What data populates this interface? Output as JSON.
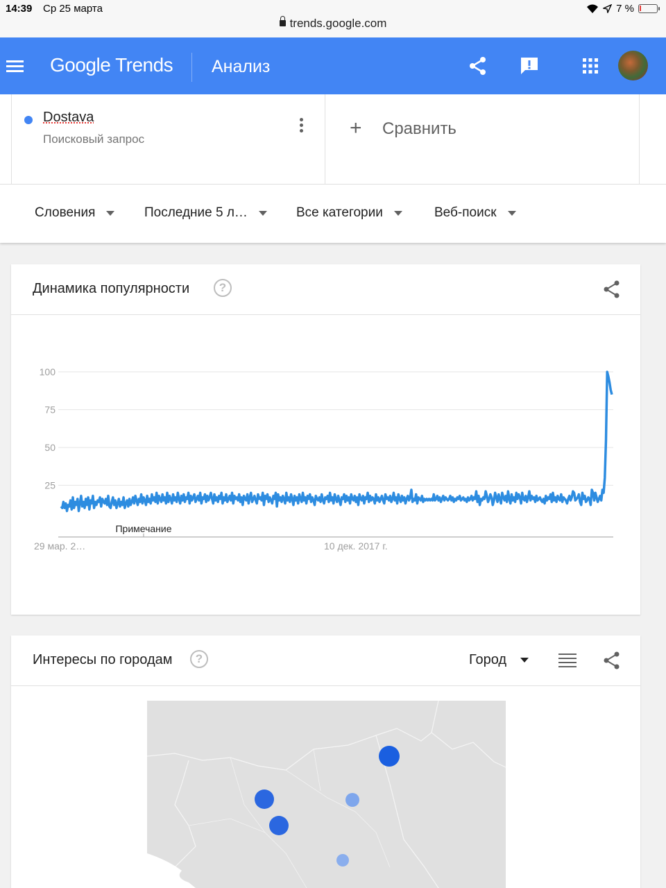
{
  "status_bar": {
    "time": "14:39",
    "date": "Ср 25 марта",
    "battery": "7 %"
  },
  "url": "trends.google.com",
  "app_bar": {
    "logo_google": "Google",
    "logo_trends": "Trends",
    "title": "Анализ"
  },
  "search_term": {
    "name": "Dostava",
    "type": "Поисковый запрос",
    "color": "#4285f4"
  },
  "compare": {
    "plus": "+",
    "label": "Сравнить"
  },
  "filters": [
    {
      "label": "Словения"
    },
    {
      "label": "Последние 5 л…"
    },
    {
      "label": "Все категории"
    },
    {
      "label": "Веб-поиск"
    }
  ],
  "interest_over_time": {
    "title": "Динамика популярности",
    "help": "?",
    "note_label": "Примечание"
  },
  "chart_data": {
    "type": "line",
    "title": "Динамика популярности",
    "y_ticks": [
      "100",
      "75",
      "50",
      "25"
    ],
    "x_tick_labels": [
      "29 мар. 2…",
      "10 дек. 2017 г."
    ],
    "ylim": [
      0,
      100
    ],
    "grid": true,
    "series": [
      {
        "name": "Dostava",
        "color": "#2d8ce0",
        "values": [
          11,
          10,
          14,
          10,
          13,
          8,
          12,
          11,
          15,
          9,
          17,
          10,
          14,
          12,
          16,
          8,
          13,
          18,
          11,
          14,
          10,
          16,
          12,
          17,
          9,
          15,
          13,
          18,
          10,
          14,
          12,
          15,
          14,
          17,
          11,
          16,
          14,
          13,
          16,
          12,
          18,
          11,
          10,
          14,
          17,
          12,
          15,
          10,
          13,
          16,
          11,
          14,
          12,
          17,
          10,
          13,
          15,
          11,
          16,
          12,
          14,
          17,
          13,
          18,
          15,
          12,
          16,
          14,
          19,
          13,
          17,
          15,
          12,
          18,
          14,
          16,
          13,
          19,
          15,
          17,
          14,
          20,
          13,
          18,
          16,
          14,
          19,
          15,
          17,
          13,
          20,
          14,
          18,
          16,
          13,
          19,
          15,
          17,
          14,
          20,
          16,
          13,
          18,
          15,
          19,
          14,
          17,
          16,
          20,
          13,
          18,
          15,
          17,
          19,
          14,
          16,
          18,
          15,
          20,
          13,
          17,
          16,
          19,
          14,
          18,
          15,
          17,
          20,
          16,
          13,
          19,
          15,
          17,
          14,
          18,
          16,
          20,
          13,
          17,
          15,
          19,
          14,
          16,
          18,
          15,
          20,
          13,
          18,
          16,
          17,
          15,
          19,
          14,
          17,
          12,
          18,
          16,
          15,
          19,
          13,
          17,
          20,
          14,
          16,
          18,
          15,
          13,
          19,
          16,
          17,
          15,
          20,
          12,
          18,
          16,
          19,
          14,
          17,
          15,
          13,
          18,
          16,
          20,
          11,
          19,
          15,
          17,
          14,
          18,
          16,
          13,
          20,
          15,
          17,
          14,
          19,
          16,
          12,
          18,
          15,
          17,
          13,
          19,
          16,
          14,
          20,
          15,
          17,
          13,
          18,
          16,
          19,
          14,
          17,
          15,
          12,
          18,
          16,
          15,
          17,
          14,
          19,
          15,
          13,
          17,
          16,
          18,
          14,
          20,
          15,
          17,
          13,
          19,
          16,
          14,
          18,
          15,
          12,
          17,
          16,
          19,
          14,
          18,
          15,
          17,
          13,
          19,
          16,
          15,
          18,
          14,
          17,
          12,
          19,
          16,
          15,
          18,
          13,
          17,
          16,
          20,
          14,
          18,
          15,
          17,
          16,
          13,
          19,
          15,
          17,
          14,
          16,
          18,
          15,
          13,
          19,
          16,
          17,
          15,
          18,
          14,
          16,
          20,
          15,
          17,
          13,
          19,
          16,
          14,
          18,
          15,
          17,
          13,
          16,
          18,
          15,
          17,
          22,
          14,
          16,
          15,
          19,
          13,
          17,
          16,
          15,
          18,
          14,
          16,
          15,
          16,
          15,
          16,
          15,
          16,
          15,
          19,
          15,
          16,
          18,
          15,
          17,
          14,
          16,
          18,
          15,
          17,
          16,
          15,
          16,
          18,
          15,
          17,
          14,
          16,
          15,
          17,
          16,
          18,
          15,
          16,
          17,
          15,
          16,
          14,
          17,
          15,
          16,
          18,
          15,
          17,
          16,
          21,
          14,
          18,
          12,
          16,
          15,
          17,
          16,
          21,
          18,
          14,
          16,
          19,
          17,
          12,
          15,
          20,
          17,
          14,
          19,
          16,
          13,
          20,
          17,
          15,
          18,
          14,
          21,
          16,
          13,
          19,
          15,
          17,
          14,
          20,
          16,
          19,
          17,
          13,
          20,
          16,
          15,
          18,
          14,
          17,
          21,
          15,
          18,
          16,
          17,
          14,
          18,
          15,
          16,
          17,
          15,
          14,
          16,
          13,
          18,
          15,
          17,
          16,
          19,
          14,
          20,
          15,
          17,
          14,
          18,
          16,
          15,
          19,
          14,
          17,
          16,
          15,
          13,
          16,
          18,
          15,
          17,
          21,
          20,
          15,
          16,
          17,
          19,
          14,
          12,
          20,
          16,
          18,
          14,
          15,
          17,
          16,
          12,
          22,
          20,
          15,
          20,
          17,
          14,
          16,
          18,
          15,
          22,
          20,
          30,
          55,
          100,
          97,
          93,
          88,
          85
        ]
      }
    ]
  },
  "interest_by_city": {
    "title": "Интересы по городам",
    "help": "?",
    "resolution": "Город"
  },
  "map_data": {
    "points": [
      {
        "level": "high",
        "color": "#1a5fe0"
      },
      {
        "level": "high",
        "color": "#2b67e0"
      },
      {
        "level": "high",
        "color": "#2b67e0"
      },
      {
        "level": "medium",
        "color": "#7ea6ec"
      },
      {
        "level": "low",
        "color": "#8aaeed"
      }
    ]
  }
}
